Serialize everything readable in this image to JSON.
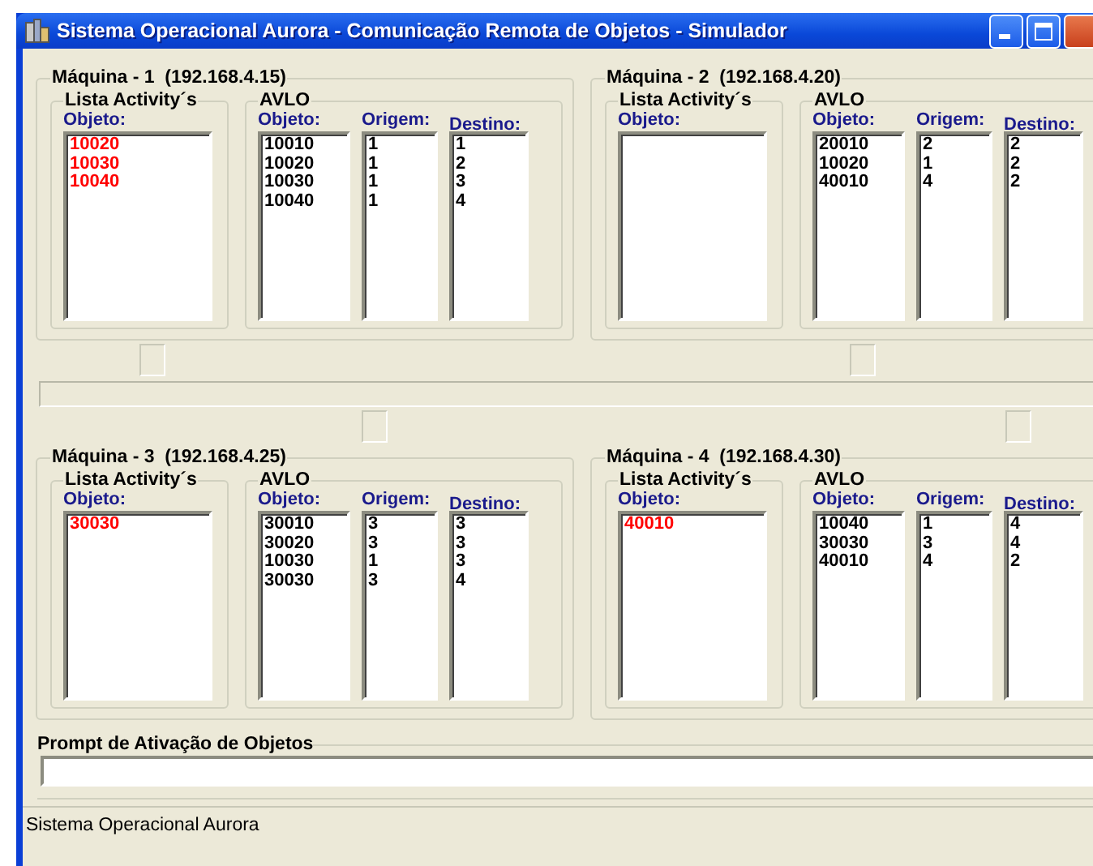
{
  "window": {
    "title": "Sistema Operacional Aurora - Comunicação Remota de Objetos - Simulador"
  },
  "machines": [
    {
      "title": "Máquina - 1  (192.168.4.15)",
      "activity_group": "Lista Activity´s",
      "activity_header": "Objeto:",
      "activities": [
        "10020",
        "10030",
        "10040"
      ],
      "avlo_group": "AVLO",
      "avlo_columns": [
        "Objeto:",
        "Origem:",
        "Destino:"
      ],
      "avlo_rows": [
        [
          "10010",
          "1",
          "1"
        ],
        [
          "10020",
          "1",
          "2"
        ],
        [
          "10030",
          "1",
          "3"
        ],
        [
          "10040",
          "1",
          "4"
        ]
      ]
    },
    {
      "title": "Máquina - 2  (192.168.4.20)",
      "activity_group": "Lista Activity´s",
      "activity_header": "Objeto:",
      "avlo_group": "AVLO",
      "avlo_columns": [
        "Objeto:",
        "Origem:",
        "Destino:"
      ],
      "avlo_rows": [
        [
          "20010",
          "2",
          "2"
        ],
        [
          "10020",
          "1",
          "2"
        ],
        [
          "40010",
          "4",
          "2"
        ]
      ]
    },
    {
      "title": "Máquina - 3  (192.168.4.25)",
      "activity_group": "Lista Activity´s",
      "activity_header": "Objeto:",
      "activities": [
        "30030"
      ],
      "avlo_group": "AVLO",
      "avlo_columns": [
        "Objeto:",
        "Origem:",
        "Destino:"
      ],
      "avlo_rows": [
        [
          "30010",
          "3",
          "3"
        ],
        [
          "30020",
          "3",
          "3"
        ],
        [
          "10030",
          "1",
          "3"
        ],
        [
          "30030",
          "3",
          "4"
        ]
      ]
    },
    {
      "title": "Máquina - 4  (192.168.4.30)",
      "activity_group": "Lista Activity´s",
      "activity_header": "Objeto:",
      "activities": [
        "40010"
      ],
      "avlo_group": "AVLO",
      "avlo_columns": [
        "Objeto:",
        "Origem:",
        "Destino:"
      ],
      "avlo_rows": [
        [
          "10040",
          "1",
          "4"
        ],
        [
          "30030",
          "3",
          "4"
        ],
        [
          "40010",
          "4",
          "2"
        ]
      ]
    }
  ],
  "prompt": {
    "label": "Prompt de Ativação de Objetos"
  },
  "status_bar": "Sistema Operacional Aurora"
}
